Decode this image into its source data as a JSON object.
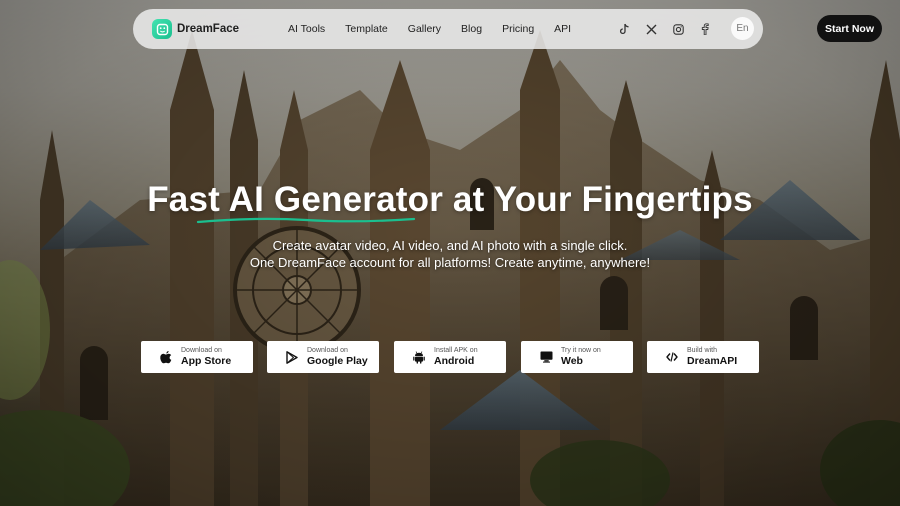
{
  "brand": {
    "name": "DreamFace"
  },
  "nav": {
    "links": [
      "AI Tools",
      "Template",
      "Gallery",
      "Blog",
      "Pricing",
      "API"
    ],
    "socials": [
      "tiktok-icon",
      "x-icon",
      "instagram-icon",
      "facebook-icon"
    ],
    "language": "En"
  },
  "cta": {
    "start_label": "Start Now"
  },
  "hero": {
    "title": "Fast AI Generator at Your Fingertips",
    "subtitle_line1": "Create avatar video, AI video, and AI photo with a single click.",
    "subtitle_line2": "One DreamFace account for all platforms! Create anytime, anywhere!"
  },
  "downloads": [
    {
      "small": "Download on",
      "big": "App Store",
      "icon": "apple-icon"
    },
    {
      "small": "Download on",
      "big": "Google Play",
      "icon": "google-play-icon"
    },
    {
      "small": "Install APK on",
      "big": "Android",
      "icon": "android-icon"
    },
    {
      "small": "Try it now on",
      "big": "Web",
      "icon": "monitor-icon"
    },
    {
      "small": "Build with",
      "big": "DreamAPI",
      "icon": "code-icon"
    }
  ],
  "colors": {
    "accent": "#1bbf8f",
    "button": "#111111",
    "nav_bg": "#ebebeb"
  }
}
